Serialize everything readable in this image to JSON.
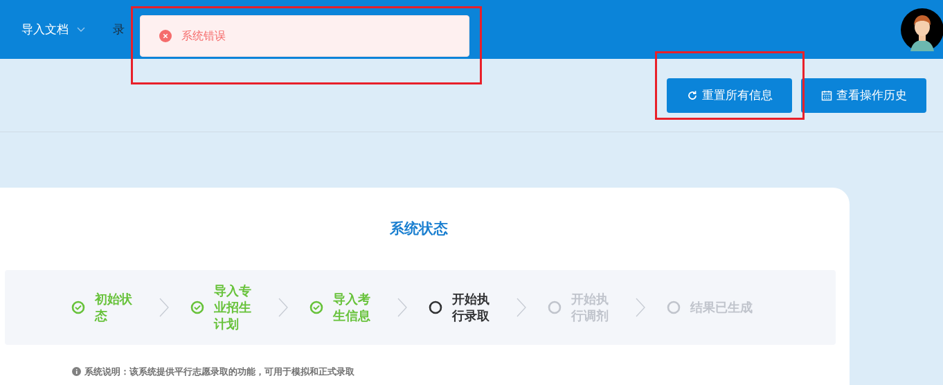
{
  "nav": {
    "items": [
      {
        "label": "导入文档",
        "dropdown": true
      },
      {
        "label": "录",
        "dropdown": false
      }
    ]
  },
  "toast": {
    "kind": "error",
    "message": "系统错误"
  },
  "toolbar": {
    "buttons": [
      {
        "label": "重置所有信息",
        "kind": "reset"
      },
      {
        "label": "查看操作历史",
        "kind": "history"
      }
    ]
  },
  "card": {
    "title": "系统状态",
    "steps": [
      {
        "label": "初始状态",
        "kind": "done"
      },
      {
        "label": "导入专业招生计划",
        "kind": "done"
      },
      {
        "label": "导入考生信息",
        "kind": "done"
      },
      {
        "label": "开始执行录取",
        "kind": "current"
      },
      {
        "label": "开始执行调剂",
        "kind": "pending"
      },
      {
        "label": "结果已生成",
        "kind": "pending"
      }
    ],
    "note": "系统说明：该系统提供平行志愿录取的功能，可用于模拟和正式录取"
  },
  "annotation_boxes": [
    {
      "color": "#e8202a"
    },
    {
      "color": "#e8202a"
    }
  ]
}
